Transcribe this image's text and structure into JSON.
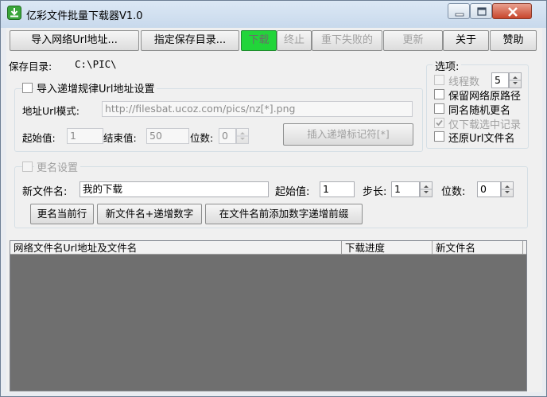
{
  "window": {
    "title": "亿彩文件批量下载器V1.0"
  },
  "toolbar": {
    "import_url": "导入网络Url地址...",
    "save_dir": "指定保存目录...",
    "download": "下载",
    "stop": "终止",
    "retry_failed": "重下失败的",
    "update": "更新",
    "about": "关于",
    "donate": "赞助"
  },
  "save": {
    "label": "保存目录:",
    "path": "C:\\PIC\\"
  },
  "increment_group": {
    "title": "导入递增规律Url地址设置",
    "url_pattern_label": "地址Url模式:",
    "url_pattern_value": "http://filesbat.ucoz.com/pics/nz[*].png",
    "start_label": "起始值:",
    "start_value": "1",
    "end_label": "结束值:",
    "end_value": "50",
    "digits_label": "位数:",
    "digits_value": "0",
    "insert_marker_button": "插入递增标记符[*]"
  },
  "options": {
    "title": "选项:",
    "threads_label": "线程数",
    "threads_value": "5",
    "keep_path": "保留网络原路径",
    "random_rename": "同名随机更名",
    "download_selected": "仅下载选中记录",
    "restore_url_name": "还原Url文件名"
  },
  "rename_group": {
    "title": "更名设置",
    "new_name_label": "新文件名:",
    "new_name_value": "我的下载",
    "start_label": "起始值:",
    "start_value": "1",
    "step_label": "步长:",
    "step_value": "1",
    "digits_label": "位数:",
    "digits_value": "0",
    "rename_current": "更名当前行",
    "name_plus_number": "新文件名+递增数字",
    "prefix_number": "在文件名前添加数字递增前缀"
  },
  "list": {
    "columns": [
      "网络文件名Url地址及文件名",
      "下载进度",
      "新文件名"
    ]
  }
}
